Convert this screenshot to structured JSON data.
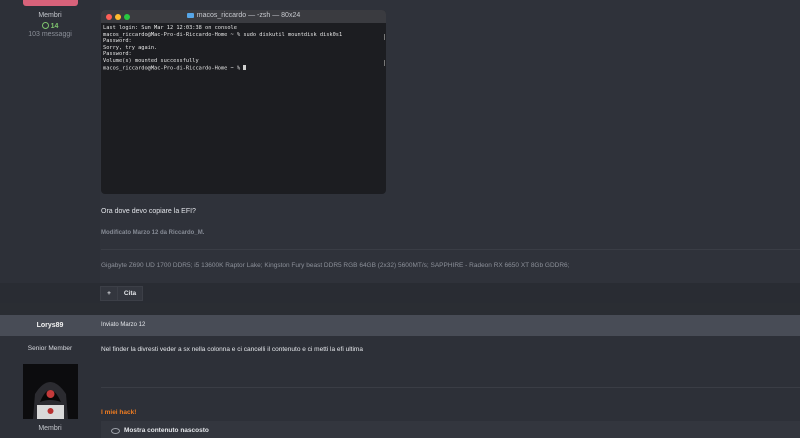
{
  "post1": {
    "author": {
      "group": "Membri",
      "reputation": "14",
      "messages": "103 messaggi"
    },
    "terminal": {
      "title": "macos_riccardo — -zsh — 80x24",
      "lines": [
        "Last login: Sun Mar 12 12:03:38 on console",
        "macos_riccardo@Mac-Pro-di-Riccardo-Home ~ % sudo diskutil mountdisk disk0s1",
        "Password:",
        "Sorry, try again.",
        "Password:",
        "Volume(s) mounted successfully",
        "macos_riccardo@Mac-Pro-di-Riccardo-Home ~ % "
      ]
    },
    "text": "Ora dove devo copiare la EFI?",
    "edited": "Modificato Marzo 12 da Riccardo_M.",
    "signature": "Gigabyte Z690 UD 1700 DDR5; i5 13600K Raptor Lake; Kingston Fury beast DDR5 RGB 64GB (2x32) 5600MT/s; SAPPHIRE - Radeon RX 6650 XT 8Gb GDDR6;",
    "actions": {
      "add_label": "+",
      "quote_label": "Cita"
    }
  },
  "post2": {
    "author": {
      "username": "Lorys89",
      "rank": "Senior Member",
      "group": "Membri"
    },
    "posted": "Inviato Marzo 12",
    "text": "Nel finder la divresti veder a sx nella colonna e ci cancelli il contenuto e ci metti la efi ultima",
    "signature": "I miei hack!",
    "spoiler": "Mostra contenuto nascosto"
  },
  "colors": {
    "accent_orange": "#f07c20",
    "reputation_green": "#7fc36e",
    "group_bar": "#d8627a"
  }
}
